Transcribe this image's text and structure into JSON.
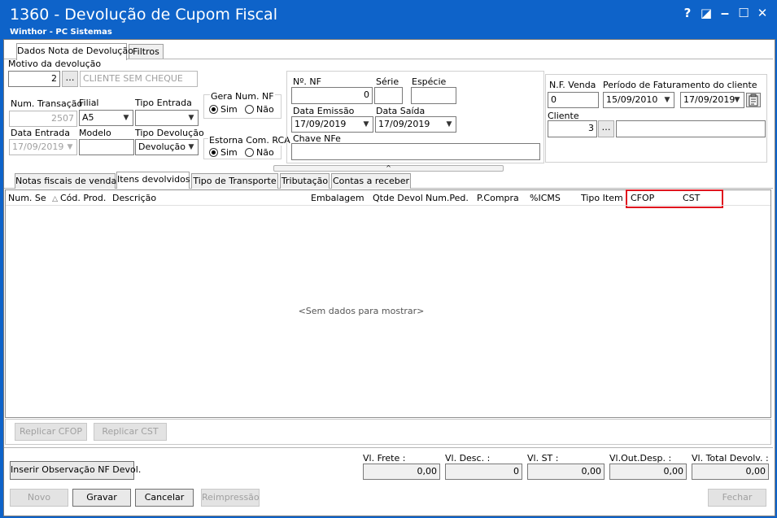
{
  "window": {
    "title": "1360 - Devolução de Cupom Fiscal",
    "subtitle": "Winthor - PC Sistemas",
    "controls": {
      "help": "?",
      "restore": "◪",
      "minimize": "‒",
      "maximize": "☐",
      "close": "✕"
    }
  },
  "top_tabs": [
    "Dados Nota de Devolução",
    "Filtros"
  ],
  "form": {
    "motivo_label": "Motivo da devolução",
    "motivo_code": "2",
    "motivo_desc": "CLIENTE SEM CHEQUE",
    "num_transacao_label": "Num. Transação",
    "num_transacao_value": "2507",
    "filial_label": "Filial",
    "filial_value": "A5",
    "tipo_entrada_label": "Tipo Entrada",
    "tipo_entrada_value": "",
    "data_entrada_label": "Data Entrada",
    "data_entrada_value": "17/09/2019",
    "modelo_label": "Modelo",
    "modelo_value": "",
    "tipo_devolucao_label": "Tipo Devolução",
    "tipo_devolucao_value": "Devolução",
    "gera_num_nf_label": "Gera Num. NF",
    "estorna_rca_label": "Estorna Com. RCA",
    "sim_label": "Sim",
    "nao_label": "Não",
    "nf_label": "Nº. NF",
    "nf_value": "0",
    "serie_label": "Série",
    "serie_value": "",
    "especie_label": "Espécie",
    "especie_value": "",
    "data_emissao_label": "Data Emissão",
    "data_emissao_value": "17/09/2019",
    "data_saida_label": "Data Saída",
    "data_saida_value": "17/09/2019",
    "chave_nfe_label": "Chave NFe",
    "chave_nfe_value": "",
    "nf_venda_label": "N.F. Venda",
    "nf_venda_value": "0",
    "periodo_label": "Período de Faturamento do cliente",
    "periodo_inicio": "15/09/2010",
    "periodo_fim": "17/09/2019",
    "cliente_label": "Cliente",
    "cliente_code": "3",
    "cliente_name": ""
  },
  "inner_tabs": [
    "Notas fiscais de venda",
    "Itens devolvidos",
    "Tipo de Transporte",
    "Tributação",
    "Contas a receber"
  ],
  "grid": {
    "columns": [
      "Num. Se",
      "Cód. Prod.",
      "Descrição",
      "Embalagem",
      "Qtde Devol",
      "Num.Ped.",
      "P.Compra",
      "%ICMS",
      "Tipo Item",
      "CFOP",
      "CST"
    ],
    "sort_indicator": "△",
    "empty_text": "<Sem dados para mostrar>",
    "highlight_color": "#e0141e"
  },
  "grid_buttons": {
    "replicar_cfop": "Replicar CFOP",
    "replicar_cst": "Replicar CST"
  },
  "totals": {
    "frete_label": "Vl. Frete :",
    "frete_value": "0,00",
    "desc_label": "Vl. Desc. :",
    "desc_value": "0",
    "st_label": "Vl. ST :",
    "st_value": "0,00",
    "outdesp_label": "Vl.Out.Desp. :",
    "outdesp_value": "0,00",
    "total_label": "Vl. Total Devolv. :",
    "total_value": "0,00"
  },
  "buttons": {
    "inserir_obs": "Inserir Observação NF Devol.",
    "novo": "Novo",
    "gravar": "Gravar",
    "cancelar": "Cancelar",
    "reimpressao": "Reimpressão",
    "fechar": "Fechar"
  },
  "colors": {
    "titlebar": "#0e63c9",
    "window_bg": "#ffffff"
  }
}
